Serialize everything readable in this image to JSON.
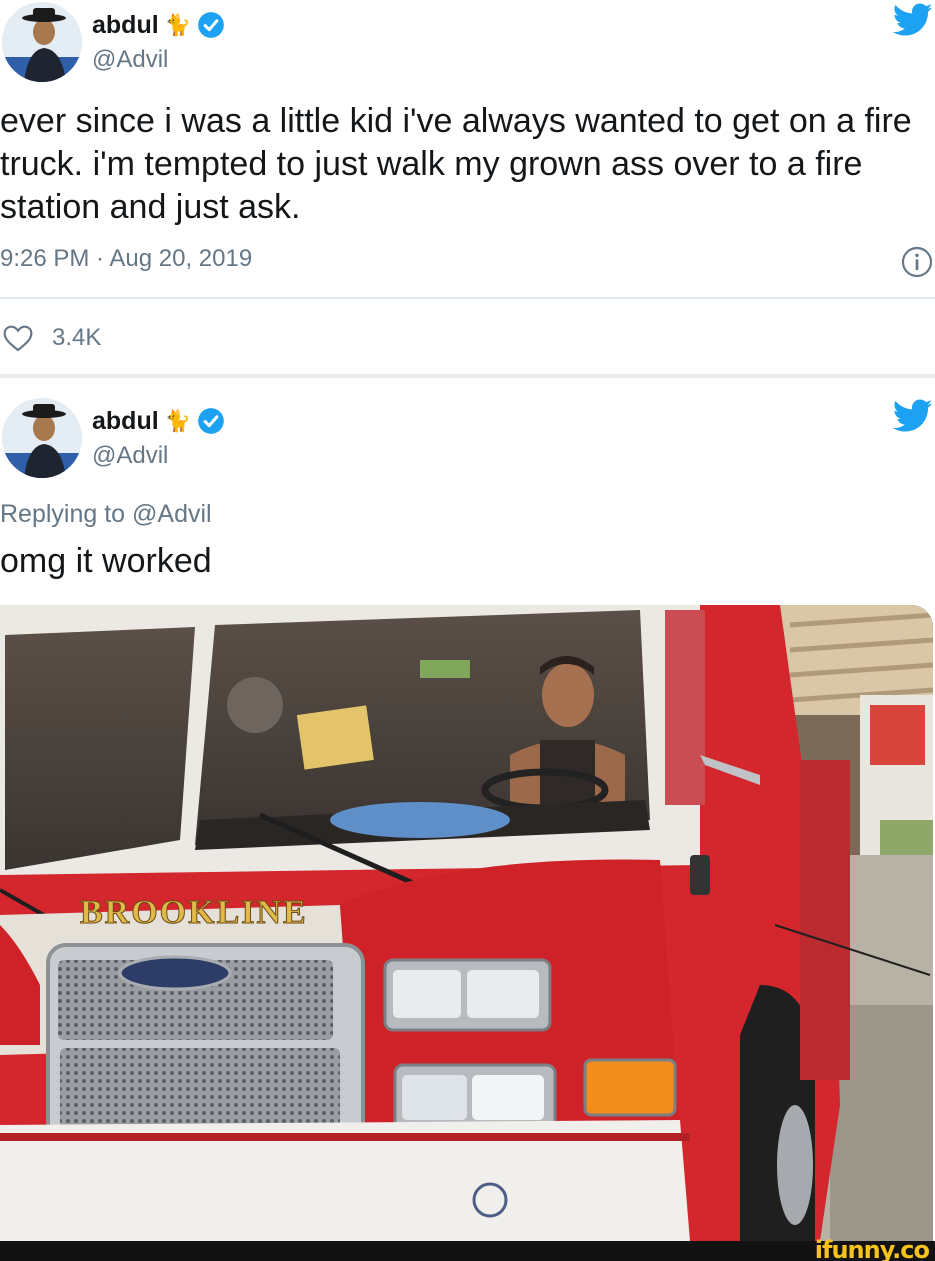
{
  "tweet": {
    "author": {
      "display_name": "abdul",
      "name_emoji": "🐈",
      "handle": "@Advil",
      "avatar_icon": "user-avatar",
      "verified_icon": "verified-badge-icon"
    },
    "text": "ever since i was a little kid i've always wanted to get on a fire truck. i'm tempted to just walk my grown ass over to a fire station and just ask.",
    "timestamp": "9:26 PM · Aug 20, 2019",
    "likes": "3.4K",
    "like_icon": "heart-icon",
    "info_icon": "info-icon",
    "brand_icon": "twitter-bird-icon"
  },
  "reply": {
    "author": {
      "display_name": "abdul",
      "name_emoji": "🐈",
      "handle": "@Advil"
    },
    "replying_to": "Replying to @Advil",
    "text": "omg it worked",
    "photo": {
      "truck_lettering": "BROOKLINE"
    }
  },
  "watermark": "ifunny.co",
  "colors": {
    "twitter_blue": "#1da1f2",
    "secondary_text": "#657786",
    "truck_red": "#c8242b",
    "watermark_yellow": "#f7c21e"
  }
}
